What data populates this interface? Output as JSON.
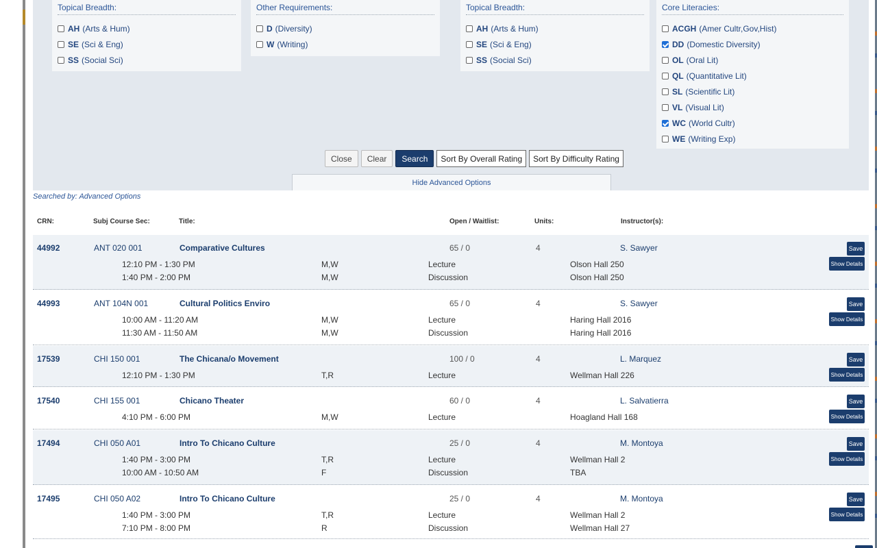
{
  "filters": {
    "box1": {
      "title": "Topical Breadth:",
      "items": [
        {
          "code": "AH",
          "label": "(Arts & Hum)",
          "checked": false
        },
        {
          "code": "SE",
          "label": "(Sci & Eng)",
          "checked": false
        },
        {
          "code": "SS",
          "label": "(Social Sci)",
          "checked": false
        }
      ]
    },
    "box2": {
      "title": "Other Requirements:",
      "items": [
        {
          "code": "D",
          "label": "(Diversity)",
          "checked": false
        },
        {
          "code": "W",
          "label": "(Writing)",
          "checked": false
        }
      ]
    },
    "box3": {
      "title": "Topical Breadth:",
      "items": [
        {
          "code": "AH",
          "label": "(Arts & Hum)",
          "checked": false
        },
        {
          "code": "SE",
          "label": "(Sci & Eng)",
          "checked": false
        },
        {
          "code": "SS",
          "label": "(Social Sci)",
          "checked": false
        }
      ]
    },
    "box4": {
      "title": "Core Literacies:",
      "items": [
        {
          "code": "ACGH",
          "label": "(Amer Cultr,Gov,Hist)",
          "checked": false
        },
        {
          "code": "DD",
          "label": "(Domestic Diversity)",
          "checked": true
        },
        {
          "code": "OL",
          "label": "(Oral Lit)",
          "checked": false
        },
        {
          "code": "QL",
          "label": "(Quantitative Lit)",
          "checked": false
        },
        {
          "code": "SL",
          "label": "(Scientific Lit)",
          "checked": false
        },
        {
          "code": "VL",
          "label": "(Visual Lit)",
          "checked": false
        },
        {
          "code": "WC",
          "label": "(World Cultr)",
          "checked": true
        },
        {
          "code": "WE",
          "label": "(Writing Exp)",
          "checked": false
        }
      ]
    }
  },
  "buttons": {
    "close": "Close",
    "clear": "Clear",
    "search": "Search",
    "sort_overall": "Sort By Overall Rating",
    "sort_difficulty": "Sort By Difficulty Rating",
    "hide_advanced": "Hide Advanced Options"
  },
  "searched_by": "Searched by: Advanced Options",
  "columns": {
    "crn": "CRN:",
    "subj": "Subj Course Sec:",
    "title": "Title:",
    "open": "Open / Waitlist:",
    "units": "Units:",
    "instructor": "Instructor(s):"
  },
  "row_buttons": {
    "save": "Save",
    "details": "Show Details"
  },
  "courses": [
    {
      "crn": "44992",
      "subj": "ANT 020 001",
      "title": "Comparative Cultures",
      "open": "65 / 0",
      "units": "4",
      "instructor": "S. Sawyer",
      "meetings": [
        {
          "time": "12:10 PM - 1:30 PM",
          "days": "M,W",
          "type": "Lecture",
          "loc": "Olson Hall 250"
        },
        {
          "time": "1:40 PM - 2:00 PM",
          "days": "M,W",
          "type": "Discussion",
          "loc": "Olson Hall 250"
        }
      ]
    },
    {
      "crn": "44993",
      "subj": "ANT 104N 001",
      "title": "Cultural Politics Enviro",
      "open": "65 / 0",
      "units": "4",
      "instructor": "S. Sawyer",
      "meetings": [
        {
          "time": "10:00 AM - 11:20 AM",
          "days": "M,W",
          "type": "Lecture",
          "loc": "Haring Hall 2016"
        },
        {
          "time": "11:30 AM - 11:50 AM",
          "days": "M,W",
          "type": "Discussion",
          "loc": "Haring Hall 2016"
        }
      ]
    },
    {
      "crn": "17539",
      "subj": "CHI 150 001",
      "title": "The Chicana/o Movement",
      "open": "100 / 0",
      "units": "4",
      "instructor": "L. Marquez",
      "meetings": [
        {
          "time": "12:10 PM - 1:30 PM",
          "days": "T,R",
          "type": "Lecture",
          "loc": "Wellman Hall 226"
        }
      ]
    },
    {
      "crn": "17540",
      "subj": "CHI 155 001",
      "title": "Chicano Theater",
      "open": "60 / 0",
      "units": "4",
      "instructor": "L. Salvatierra",
      "meetings": [
        {
          "time": "4:10 PM - 6:00 PM",
          "days": "M,W",
          "type": "Lecture",
          "loc": "Hoagland Hall 168"
        }
      ]
    },
    {
      "crn": "17494",
      "subj": "CHI 050 A01",
      "title": "Intro To Chicano Culture",
      "open": "25 / 0",
      "units": "4",
      "instructor": "M. Montoya",
      "meetings": [
        {
          "time": "1:40 PM - 3:00 PM",
          "days": "T,R",
          "type": "Lecture",
          "loc": "Wellman Hall 2"
        },
        {
          "time": "10:00 AM - 10:50 AM",
          "days": "F",
          "type": "Discussion",
          "loc": "TBA"
        }
      ]
    },
    {
      "crn": "17495",
      "subj": "CHI 050 A02",
      "title": "Intro To Chicano Culture",
      "open": "25 / 0",
      "units": "4",
      "instructor": "M. Montoya",
      "meetings": [
        {
          "time": "1:40 PM - 3:00 PM",
          "days": "T,R",
          "type": "Lecture",
          "loc": "Wellman Hall 2"
        },
        {
          "time": "7:10 PM - 8:00 PM",
          "days": "R",
          "type": "Discussion",
          "loc": "Wellman Hall 27"
        }
      ]
    }
  ]
}
